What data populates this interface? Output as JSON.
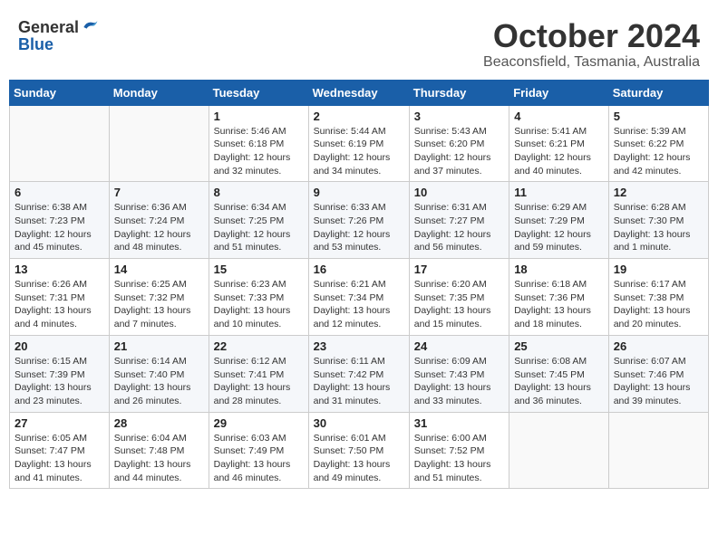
{
  "header": {
    "logo_general": "General",
    "logo_blue": "Blue",
    "title": "October 2024",
    "subtitle": "Beaconsfield, Tasmania, Australia"
  },
  "days_of_week": [
    "Sunday",
    "Monday",
    "Tuesday",
    "Wednesday",
    "Thursday",
    "Friday",
    "Saturday"
  ],
  "weeks": [
    [
      {
        "day": "",
        "info": ""
      },
      {
        "day": "",
        "info": ""
      },
      {
        "day": "1",
        "info": "Sunrise: 5:46 AM\nSunset: 6:18 PM\nDaylight: 12 hours and 32 minutes."
      },
      {
        "day": "2",
        "info": "Sunrise: 5:44 AM\nSunset: 6:19 PM\nDaylight: 12 hours and 34 minutes."
      },
      {
        "day": "3",
        "info": "Sunrise: 5:43 AM\nSunset: 6:20 PM\nDaylight: 12 hours and 37 minutes."
      },
      {
        "day": "4",
        "info": "Sunrise: 5:41 AM\nSunset: 6:21 PM\nDaylight: 12 hours and 40 minutes."
      },
      {
        "day": "5",
        "info": "Sunrise: 5:39 AM\nSunset: 6:22 PM\nDaylight: 12 hours and 42 minutes."
      }
    ],
    [
      {
        "day": "6",
        "info": "Sunrise: 6:38 AM\nSunset: 7:23 PM\nDaylight: 12 hours and 45 minutes."
      },
      {
        "day": "7",
        "info": "Sunrise: 6:36 AM\nSunset: 7:24 PM\nDaylight: 12 hours and 48 minutes."
      },
      {
        "day": "8",
        "info": "Sunrise: 6:34 AM\nSunset: 7:25 PM\nDaylight: 12 hours and 51 minutes."
      },
      {
        "day": "9",
        "info": "Sunrise: 6:33 AM\nSunset: 7:26 PM\nDaylight: 12 hours and 53 minutes."
      },
      {
        "day": "10",
        "info": "Sunrise: 6:31 AM\nSunset: 7:27 PM\nDaylight: 12 hours and 56 minutes."
      },
      {
        "day": "11",
        "info": "Sunrise: 6:29 AM\nSunset: 7:29 PM\nDaylight: 12 hours and 59 minutes."
      },
      {
        "day": "12",
        "info": "Sunrise: 6:28 AM\nSunset: 7:30 PM\nDaylight: 13 hours and 1 minute."
      }
    ],
    [
      {
        "day": "13",
        "info": "Sunrise: 6:26 AM\nSunset: 7:31 PM\nDaylight: 13 hours and 4 minutes."
      },
      {
        "day": "14",
        "info": "Sunrise: 6:25 AM\nSunset: 7:32 PM\nDaylight: 13 hours and 7 minutes."
      },
      {
        "day": "15",
        "info": "Sunrise: 6:23 AM\nSunset: 7:33 PM\nDaylight: 13 hours and 10 minutes."
      },
      {
        "day": "16",
        "info": "Sunrise: 6:21 AM\nSunset: 7:34 PM\nDaylight: 13 hours and 12 minutes."
      },
      {
        "day": "17",
        "info": "Sunrise: 6:20 AM\nSunset: 7:35 PM\nDaylight: 13 hours and 15 minutes."
      },
      {
        "day": "18",
        "info": "Sunrise: 6:18 AM\nSunset: 7:36 PM\nDaylight: 13 hours and 18 minutes."
      },
      {
        "day": "19",
        "info": "Sunrise: 6:17 AM\nSunset: 7:38 PM\nDaylight: 13 hours and 20 minutes."
      }
    ],
    [
      {
        "day": "20",
        "info": "Sunrise: 6:15 AM\nSunset: 7:39 PM\nDaylight: 13 hours and 23 minutes."
      },
      {
        "day": "21",
        "info": "Sunrise: 6:14 AM\nSunset: 7:40 PM\nDaylight: 13 hours and 26 minutes."
      },
      {
        "day": "22",
        "info": "Sunrise: 6:12 AM\nSunset: 7:41 PM\nDaylight: 13 hours and 28 minutes."
      },
      {
        "day": "23",
        "info": "Sunrise: 6:11 AM\nSunset: 7:42 PM\nDaylight: 13 hours and 31 minutes."
      },
      {
        "day": "24",
        "info": "Sunrise: 6:09 AM\nSunset: 7:43 PM\nDaylight: 13 hours and 33 minutes."
      },
      {
        "day": "25",
        "info": "Sunrise: 6:08 AM\nSunset: 7:45 PM\nDaylight: 13 hours and 36 minutes."
      },
      {
        "day": "26",
        "info": "Sunrise: 6:07 AM\nSunset: 7:46 PM\nDaylight: 13 hours and 39 minutes."
      }
    ],
    [
      {
        "day": "27",
        "info": "Sunrise: 6:05 AM\nSunset: 7:47 PM\nDaylight: 13 hours and 41 minutes."
      },
      {
        "day": "28",
        "info": "Sunrise: 6:04 AM\nSunset: 7:48 PM\nDaylight: 13 hours and 44 minutes."
      },
      {
        "day": "29",
        "info": "Sunrise: 6:03 AM\nSunset: 7:49 PM\nDaylight: 13 hours and 46 minutes."
      },
      {
        "day": "30",
        "info": "Sunrise: 6:01 AM\nSunset: 7:50 PM\nDaylight: 13 hours and 49 minutes."
      },
      {
        "day": "31",
        "info": "Sunrise: 6:00 AM\nSunset: 7:52 PM\nDaylight: 13 hours and 51 minutes."
      },
      {
        "day": "",
        "info": ""
      },
      {
        "day": "",
        "info": ""
      }
    ]
  ]
}
